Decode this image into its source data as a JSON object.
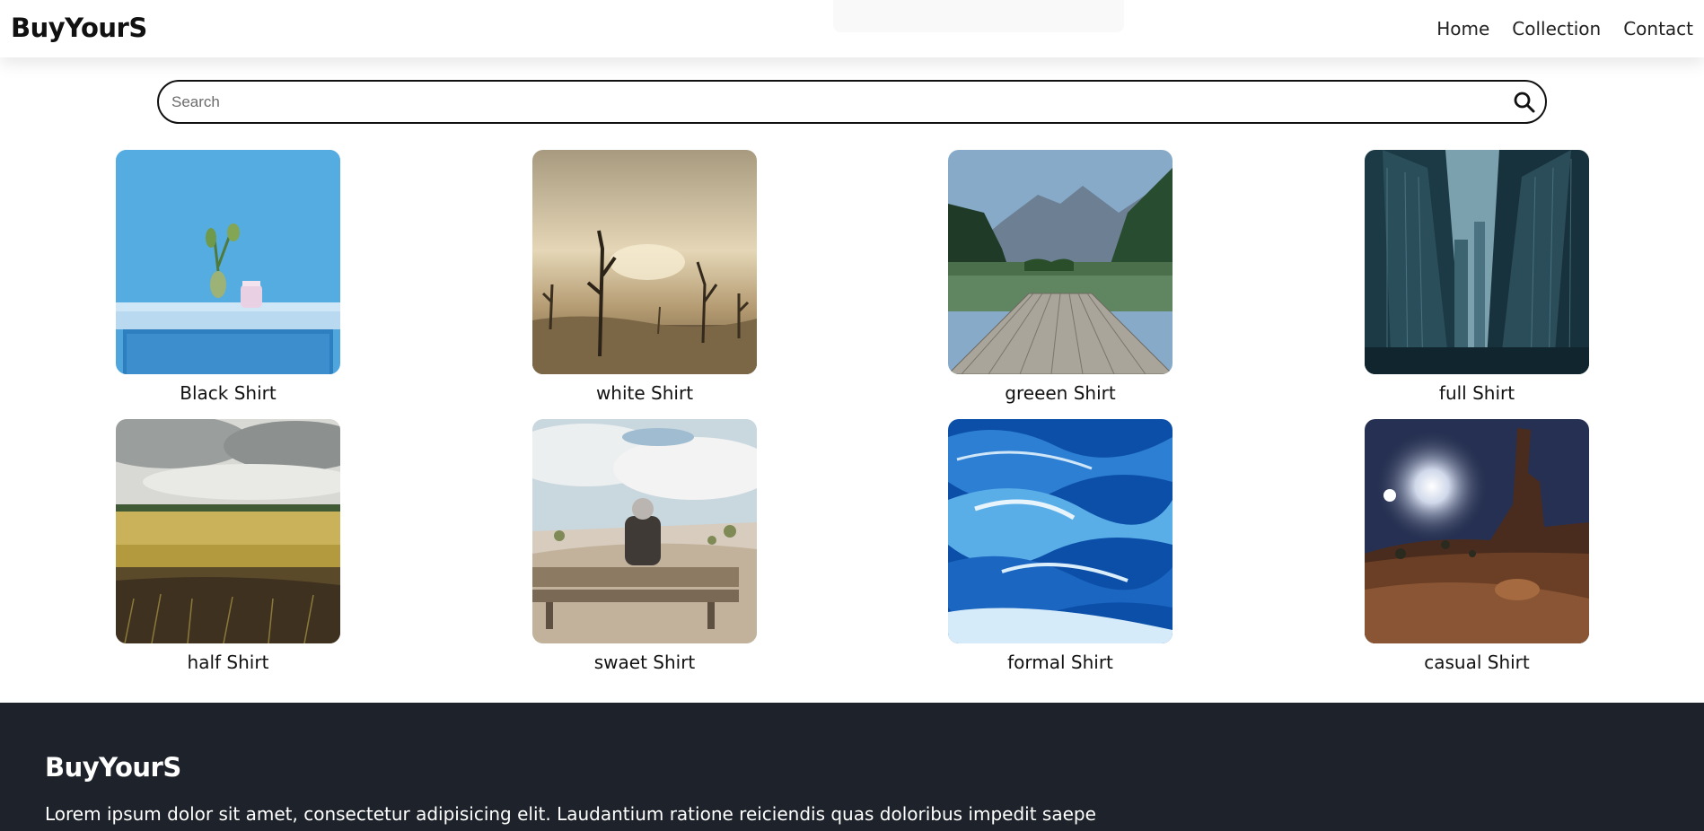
{
  "header": {
    "brand": "BuyYourS",
    "nav": [
      {
        "label": "Home"
      },
      {
        "label": "Collection"
      },
      {
        "label": "Contact"
      }
    ]
  },
  "search": {
    "placeholder": "Search",
    "value": "",
    "icon": "search-icon"
  },
  "products": [
    {
      "name": "Black Shirt",
      "image": "blue-wall-table-vase"
    },
    {
      "name": "white Shirt",
      "image": "misty-dead-trees"
    },
    {
      "name": "greeen Shirt",
      "image": "lake-pier-mountains"
    },
    {
      "name": "full Shirt",
      "image": "city-skyscrapers"
    },
    {
      "name": "half Shirt",
      "image": "wheat-field-clouds"
    },
    {
      "name": "swaet Shirt",
      "image": "person-on-bench-dunes"
    },
    {
      "name": "formal Shirt",
      "image": "blue-ocean-waves"
    },
    {
      "name": "casual Shirt",
      "image": "desert-night-moon"
    }
  ],
  "footer": {
    "brand": "BuyYourS",
    "text": "Lorem ipsum dolor sit amet, consectetur adipisicing elit. Laudantium ratione reiciendis quas doloribus impedit saepe"
  },
  "colors": {
    "footer_bg": "#1e232b",
    "text": "#111111",
    "background": "#ffffff"
  }
}
